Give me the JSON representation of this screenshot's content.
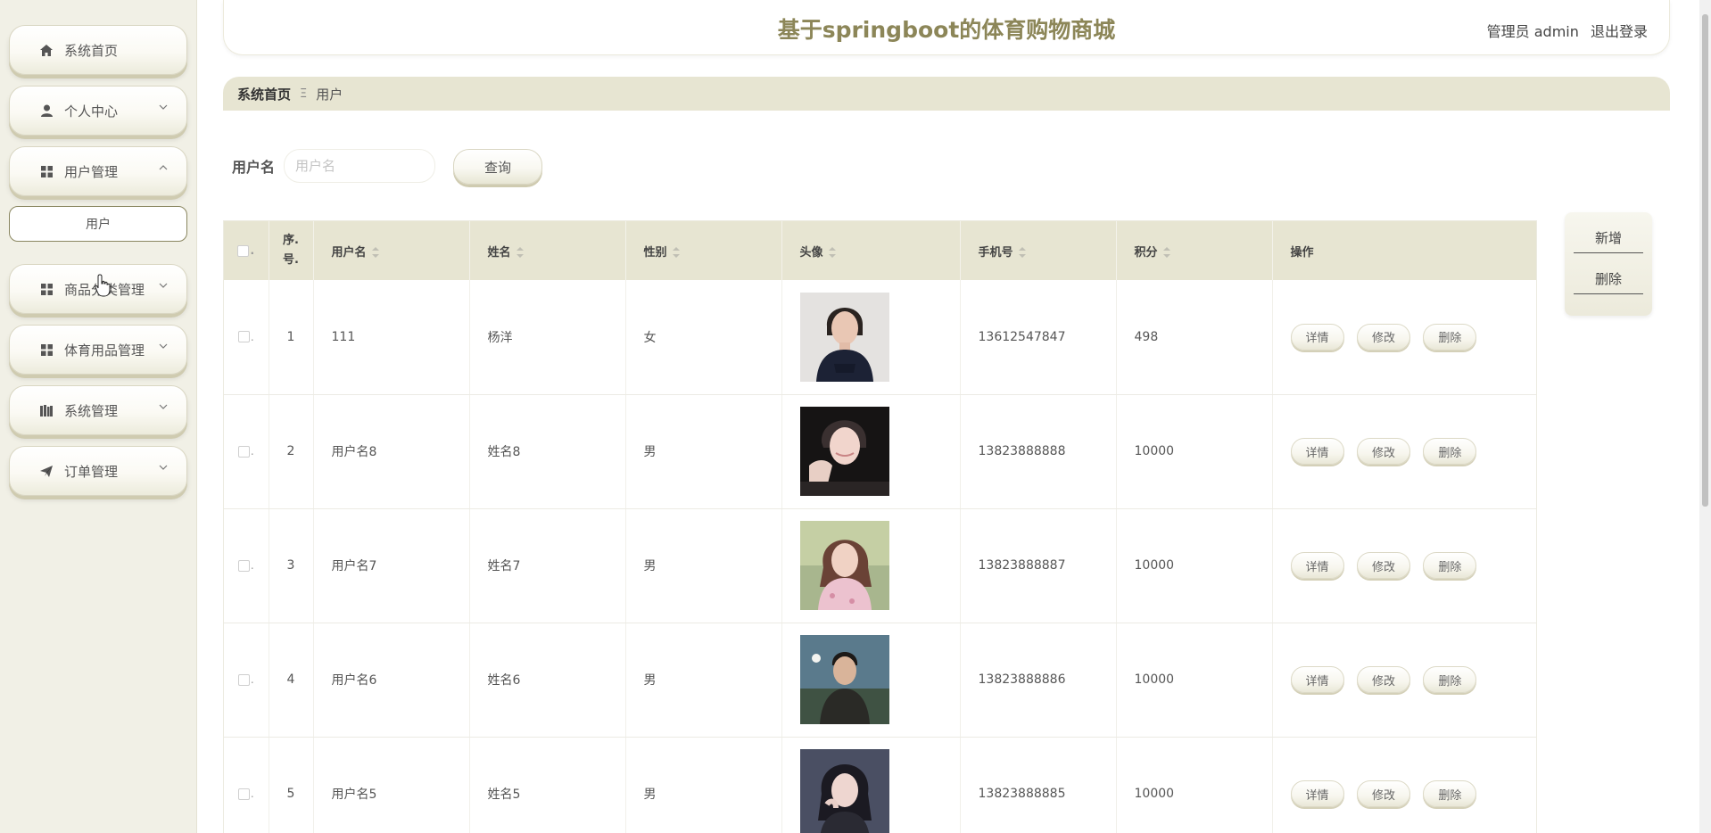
{
  "app": {
    "title": "基于springboot的体育购物商城",
    "role_user": "管理员 admin",
    "logout": "退出登录"
  },
  "sidebar": {
    "items": [
      {
        "label": "系统首页",
        "icon": "home-icon",
        "has_chevron": false
      },
      {
        "label": "个人中心",
        "icon": "user-icon",
        "has_chevron": true
      },
      {
        "label": "用户管理",
        "icon": "grid-icon",
        "has_chevron": true,
        "expanded": true
      },
      {
        "label": "商品分类管理",
        "icon": "grid-icon",
        "has_chevron": true
      },
      {
        "label": "体育用品管理",
        "icon": "grid-icon",
        "has_chevron": true
      },
      {
        "label": "系统管理",
        "icon": "books-icon",
        "has_chevron": true
      },
      {
        "label": "订单管理",
        "icon": "paper-plane-icon",
        "has_chevron": true
      }
    ],
    "submenu": {
      "label": "用户"
    }
  },
  "breadcrumb": {
    "home": "系统首页",
    "separator": "Ξ",
    "current": "用户"
  },
  "search": {
    "label": "用户名",
    "placeholder": "用户名",
    "value": "",
    "button": "查询"
  },
  "actions": {
    "add": "新增",
    "delete": "删除"
  },
  "table": {
    "headers": {
      "index": "序.号.",
      "username": "用户名",
      "name": "姓名",
      "gender": "性别",
      "avatar": "头像",
      "phone": "手机号",
      "points": "积分",
      "ops": "操作"
    },
    "op_labels": {
      "detail": "详情",
      "edit": "修改",
      "delete": "删除"
    },
    "rows": [
      {
        "index": "1",
        "username": "111",
        "name": "杨洋",
        "gender": "女",
        "phone": "13612547847",
        "points": "498"
      },
      {
        "index": "2",
        "username": "用户名8",
        "name": "姓名8",
        "gender": "男",
        "phone": "13823888888",
        "points": "10000"
      },
      {
        "index": "3",
        "username": "用户名7",
        "name": "姓名7",
        "gender": "男",
        "phone": "13823888887",
        "points": "10000"
      },
      {
        "index": "4",
        "username": "用户名6",
        "name": "姓名6",
        "gender": "男",
        "phone": "13823888886",
        "points": "10000"
      },
      {
        "index": "5",
        "username": "用户名5",
        "name": "姓名5",
        "gender": "男",
        "phone": "13823888885",
        "points": "10000"
      }
    ]
  },
  "colors": {
    "accent": "#8c8658",
    "header_bg": "#e7e5d2",
    "sidebar_bg": "#f1f0e6"
  }
}
